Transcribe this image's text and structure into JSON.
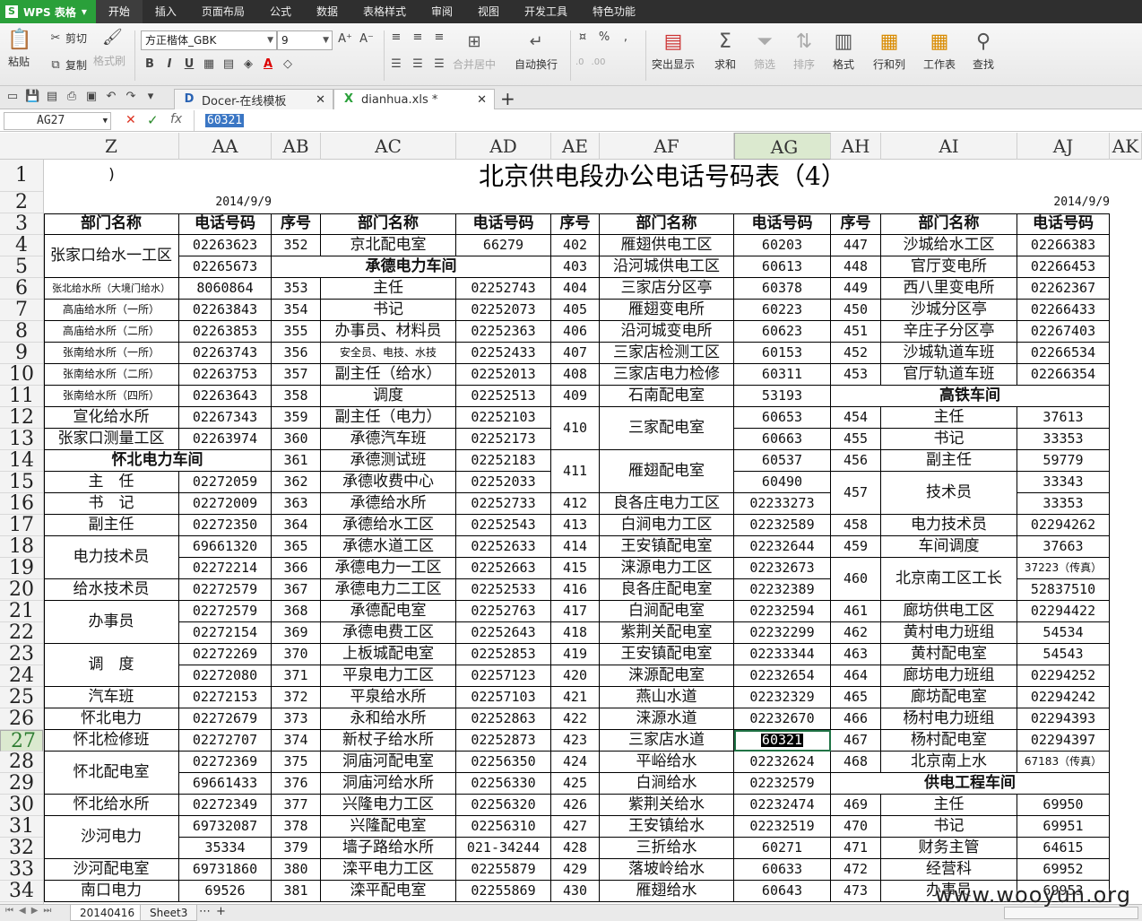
{
  "app": {
    "name": "WPS 表格",
    "logo": "S"
  },
  "menu": {
    "tabs": [
      "开始",
      "插入",
      "页面布局",
      "公式",
      "数据",
      "表格样式",
      "审阅",
      "视图",
      "开发工具",
      "特色功能"
    ],
    "active_index": 0
  },
  "ribbon": {
    "paste": "粘贴",
    "cut": "剪切",
    "copy": "复制",
    "format_painter": "格式刷",
    "font_name": "方正楷体_GBK",
    "font_size": "9",
    "bold": "B",
    "italic": "I",
    "underline": "U",
    "merge_center": "合并居中",
    "wrap_text": "自动换行",
    "highlight": "突出显示",
    "sum": "求和",
    "filter": "筛选",
    "sort": "排序",
    "format": "格式",
    "row_col": "行和列",
    "worksheet": "工作表",
    "find": "查找"
  },
  "doc_tabs": [
    {
      "label": "Docer-在线模板"
    },
    {
      "label": "dianhua.xls *"
    }
  ],
  "formula_bar": {
    "name_box": "AG27",
    "value": "60321"
  },
  "columns": [
    "Z",
    "AA",
    "AB",
    "AC",
    "AD",
    "AE",
    "AF",
    "AG",
    "AH",
    "AI",
    "AJ",
    "AK"
  ],
  "rows": [
    "1",
    "2",
    "3",
    "4",
    "5",
    "6",
    "7",
    "8",
    "9",
    "10",
    "11",
    "12",
    "13",
    "14",
    "15",
    "16",
    "17",
    "18",
    "19",
    "20",
    "21",
    "22",
    "23",
    "24",
    "25",
    "26",
    "27",
    "28",
    "29",
    "30",
    "31",
    "32",
    "33",
    "34"
  ],
  "sheet": {
    "title": "北京供电段办公电话号码表（4）",
    "row1_left": ")",
    "date_left": "2014/9/9",
    "date_right": "2014/9/9",
    "headers": [
      "部门名称",
      "电话号码",
      "序号",
      "部门名称",
      "电话号码",
      "序号",
      "部门名称",
      "电话号码",
      "序号",
      "部门名称",
      "电话号码"
    ],
    "sections": {
      "chengde": "承德电力车间",
      "huaibei": "怀北电力车间",
      "gaotie": "高铁车间",
      "gongdian": "供电工程车间"
    }
  },
  "sheet_tabs": [
    "20140416",
    "Sheet3"
  ],
  "watermark": "www.wooyun.org"
}
